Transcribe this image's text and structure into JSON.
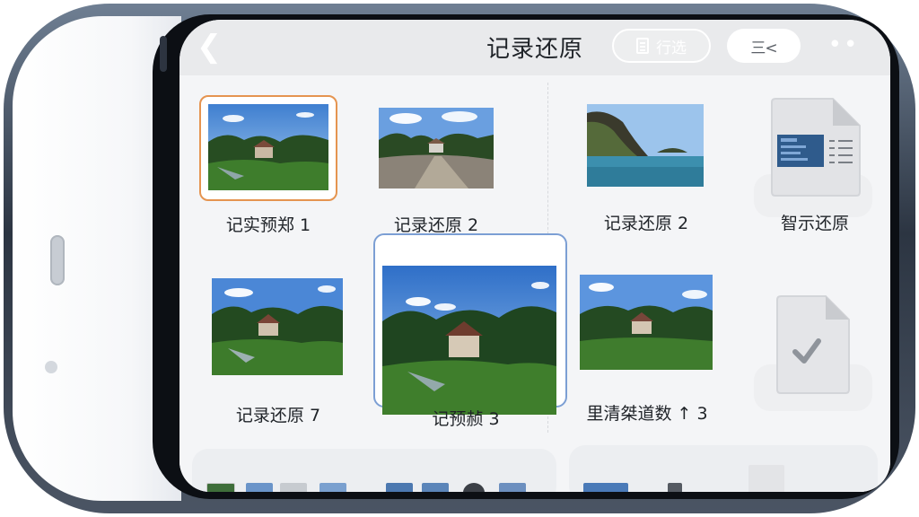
{
  "header": {
    "title": "记录还原",
    "back_icon": "chevron-left-icon",
    "filter_label": "行选",
    "filter_icon": "document-filter-icon",
    "sort_label": "三<",
    "more_label": "••"
  },
  "grid": {
    "items": [
      {
        "caption": "记实预郑 1",
        "selected": "orange"
      },
      {
        "caption": "记录还原 2"
      },
      {
        "caption": "记录还原 2"
      },
      {
        "caption": "智示还原",
        "icon": "document-chart-icon"
      },
      {
        "caption": "记录还原 7"
      },
      {
        "caption": "记预赪 3",
        "selected": "blue"
      },
      {
        "caption": "里清桀道数 ↑ 3"
      },
      {
        "caption": "",
        "icon": "document-check-icon"
      }
    ]
  },
  "colors": {
    "orange_select": "#e59450",
    "blue_select": "#7c9fd4",
    "topbar": "#e9eaec"
  }
}
